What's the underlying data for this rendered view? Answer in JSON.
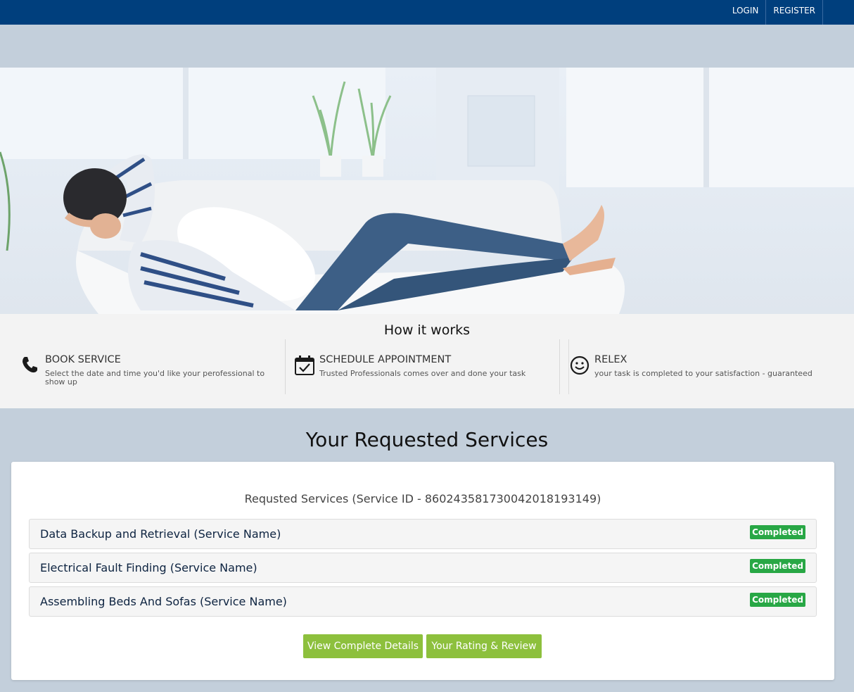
{
  "nav": {
    "login": "LOGIN",
    "register": "REGISTER"
  },
  "how_it_works": {
    "title": "How it works",
    "steps": [
      {
        "title": "BOOK SERVICE",
        "desc": "Select the date and time you'd like your perofessional to show up",
        "icon": "phone-icon"
      },
      {
        "title": "SCHEDULE APPOINTMENT",
        "desc": "Trusted Professionals comes over and done your task",
        "icon": "calendar-check-icon"
      },
      {
        "title": "RELEX",
        "desc": "your task is completed to your satisfaction - guaranteed",
        "icon": "smiley-icon"
      }
    ]
  },
  "requested": {
    "title": "Your Requested Services",
    "service_id_label": "Requsted Services (Service ID - 86024358173004201819314​9)",
    "services": [
      {
        "name": "Data Backup and Retrieval (Service Name)",
        "status": "Completed"
      },
      {
        "name": "Electrical Fault Finding (Service Name)",
        "status": "Completed"
      },
      {
        "name": "Assembling Beds And Sofas (Service Name)",
        "status": "Completed"
      }
    ],
    "buttons": {
      "details": "View Complete Details",
      "review": "Your Rating & Review"
    }
  },
  "colors": {
    "nav": "#003f7d",
    "badge": "#28a745",
    "button": "#8dc03d",
    "page_bg": "#c3cfdb"
  }
}
